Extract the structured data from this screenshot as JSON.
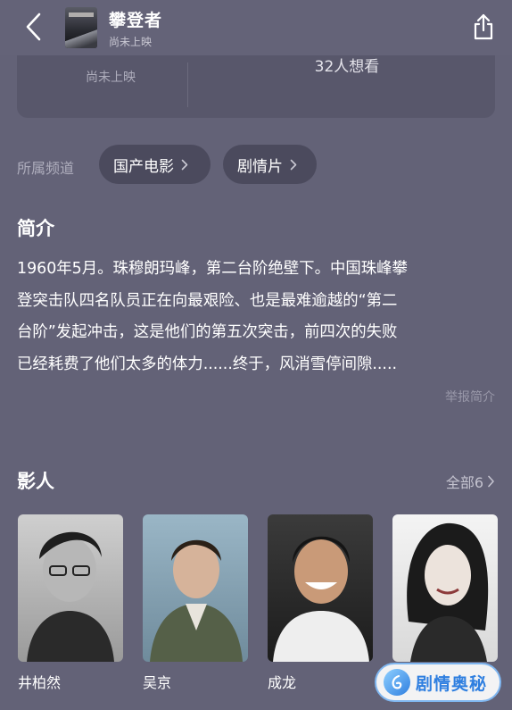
{
  "header": {
    "title": "攀登者",
    "subtitle": "尚未上映"
  },
  "stats": {
    "status": "尚未上映",
    "want_to_watch": "32人想看"
  },
  "channels": {
    "label": "所属频道",
    "items": [
      "国产电影",
      "剧情片"
    ]
  },
  "synopsis": {
    "heading": "简介",
    "text": "1960年5月。珠穆朗玛峰，第二台阶绝壁下。中国珠峰攀\n登突击队四名队员正在向最艰险、也是最难逾越的“第二\n台阶”发起冲击，这是他们的第五次突击，前四次的失败\n已经耗费了他们太多的体力......终于，风消雪停间隙.....",
    "report_label": "举报简介"
  },
  "cast": {
    "heading": "影人",
    "all_label": "全部6",
    "members": [
      {
        "name": "井柏然"
      },
      {
        "name": "吴京"
      },
      {
        "name": "成龙"
      },
      {
        "name": ""
      }
    ]
  },
  "watermark": {
    "text": "剧情奥秘"
  }
}
